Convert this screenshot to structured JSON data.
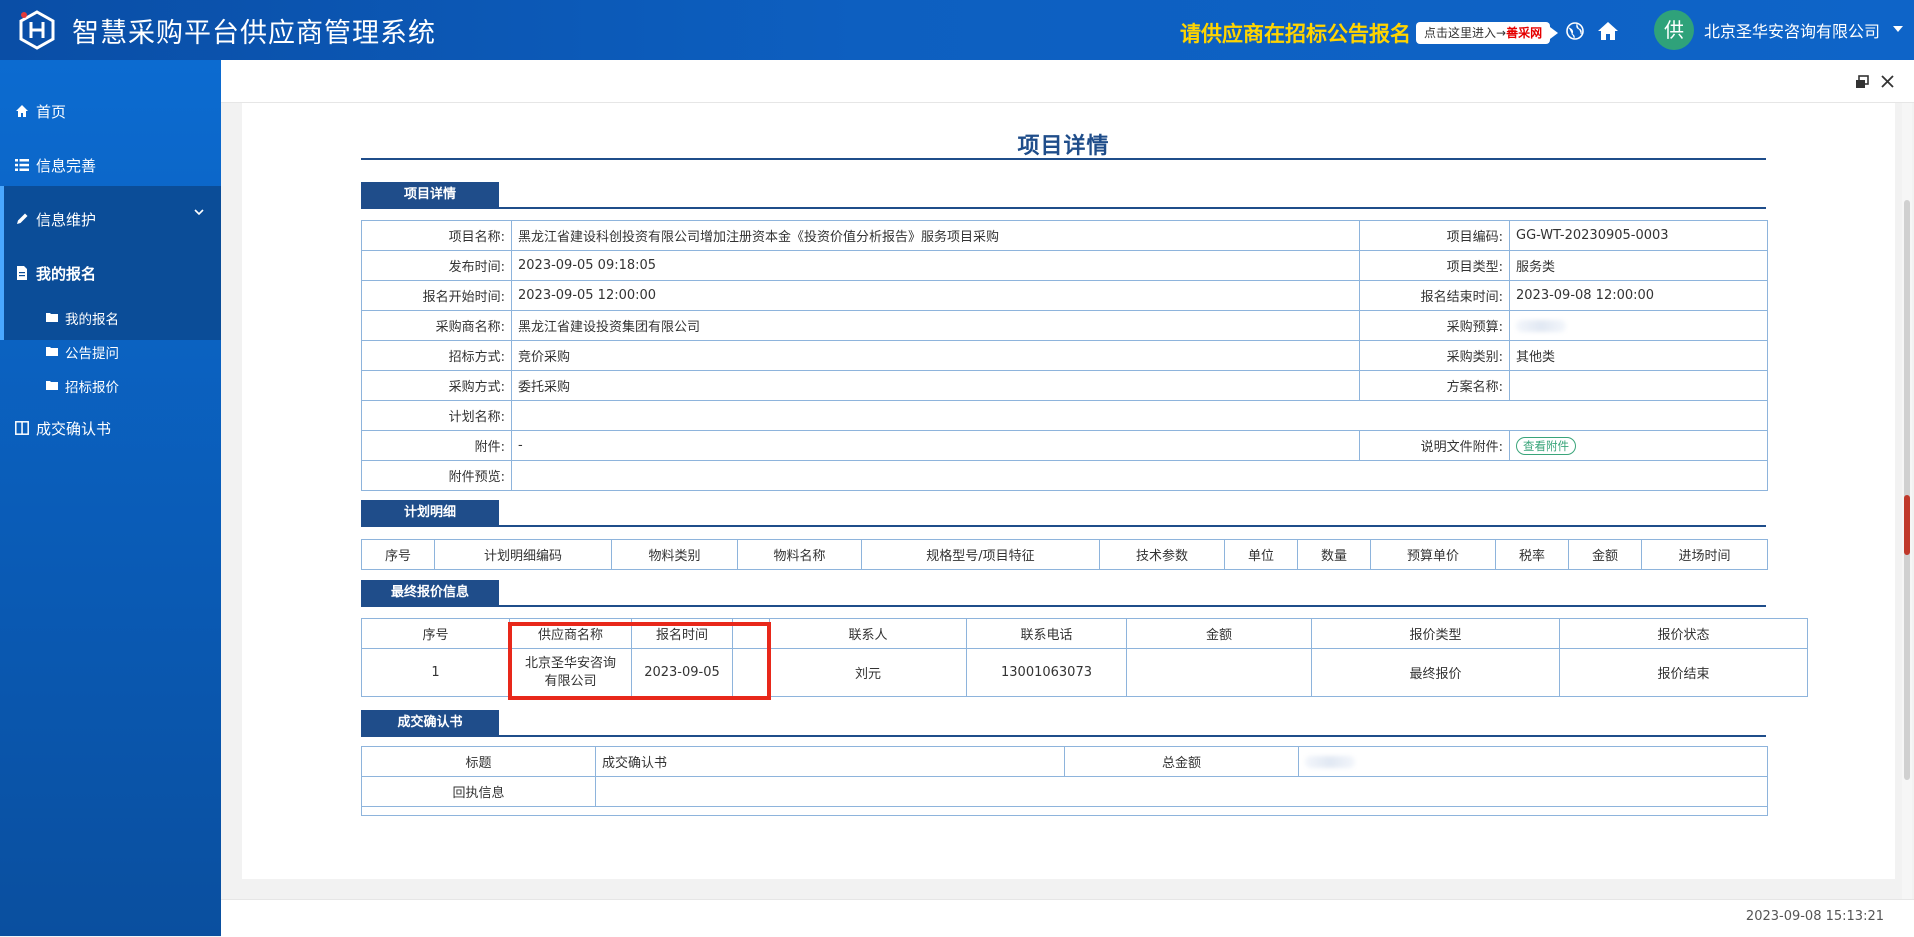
{
  "header": {
    "app_title": "智慧采购平台供应商管理系统",
    "notice": "请供应商在招标公告报名",
    "notice_link_prefix": "点击这里进入→",
    "notice_link_red": "善采网",
    "avatar_text": "供",
    "user_name": "北京圣华安咨询有限公司"
  },
  "sidebar": {
    "items": [
      {
        "label": "首页",
        "icon": "home-icon"
      },
      {
        "label": "信息完善",
        "icon": "list-icon"
      },
      {
        "label": "信息维护",
        "icon": "pencil-icon"
      },
      {
        "label": "我的报名",
        "icon": "document-icon"
      },
      {
        "label": "成交确认书",
        "icon": "columns-icon"
      }
    ],
    "subitems": [
      {
        "label": "我的报名"
      },
      {
        "label": "公告提问"
      },
      {
        "label": "招标报价"
      }
    ]
  },
  "page": {
    "title": "项目详情",
    "sections": {
      "detail": "项目详情",
      "plan": "计划明细",
      "quote": "最终报价信息",
      "confirm": "成交确认书"
    }
  },
  "detail": {
    "project_name_label": "项目名称:",
    "project_name": "黑龙江省建设科创投资有限公司增加注册资本金《投资价值分析报告》服务项目采购",
    "project_code_label": "项目编码:",
    "project_code": "GG-WT-20230905-0003",
    "publish_time_label": "发布时间:",
    "publish_time": "2023-09-05 09:18:05",
    "project_type_label": "项目类型:",
    "project_type": "服务类",
    "signup_start_label": "报名开始时间:",
    "signup_start": "2023-09-05 12:00:00",
    "signup_end_label": "报名结束时间:",
    "signup_end": "2023-09-08 12:00:00",
    "buyer_label": "采购商名称:",
    "buyer": "黑龙江省建设投资集团有限公司",
    "budget_label": "采购预算:",
    "bid_method_label": "招标方式:",
    "bid_method": "竞价采购",
    "category_label": "采购类别:",
    "category": "其他类",
    "purchase_method_label": "采购方式:",
    "purchase_method": "委托采购",
    "scheme_label": "方案名称:",
    "plan_name_label": "计划名称:",
    "attachment_label": "附件:",
    "attachment": "-",
    "doc_attachment_label": "说明文件附件:",
    "view_attachment": "查看附件",
    "attachment_preview_label": "附件预览:"
  },
  "plan_table": {
    "columns": [
      "序号",
      "计划明细编码",
      "物料类别",
      "物料名称",
      "规格型号/项目特征",
      "技术参数",
      "单位",
      "数量",
      "预算单价",
      "税率",
      "金额",
      "进场时间"
    ]
  },
  "quote_table": {
    "columns": [
      "序号",
      "供应商名称",
      "报名时间",
      "",
      "联系人",
      "联系电话",
      "金额",
      "报价类型",
      "报价状态"
    ],
    "rows": [
      {
        "index": "1",
        "supplier_line1": "北京圣华安咨询",
        "supplier_line2": "有限公司",
        "signup_time": "2023-09-05",
        "contact": "刘元",
        "phone": "13001063073",
        "amount": "",
        "quote_type": "最终报价",
        "quote_status": "报价结束"
      }
    ]
  },
  "confirm_table": {
    "title_label": "标题",
    "title_value": "成交确认书",
    "total_label": "总金额",
    "receipt_label": "回执信息"
  },
  "footer": {
    "timestamp": "2023-09-08 15:13:21"
  },
  "colors": {
    "brand_blue": "#0d5fc0",
    "section_blue": "#1f4d8a",
    "notice_yellow": "#ffd400",
    "highlight_red": "#e8281a"
  }
}
